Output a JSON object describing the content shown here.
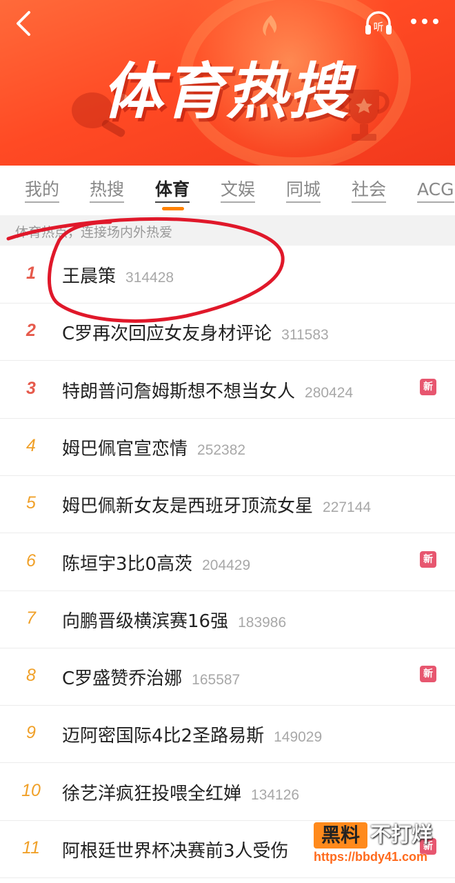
{
  "header": {
    "banner_title": "体育热搜",
    "listen_label": "听"
  },
  "tabs": [
    {
      "label": "我的"
    },
    {
      "label": "热搜"
    },
    {
      "label": "体育"
    },
    {
      "label": "文娱"
    },
    {
      "label": "同城"
    },
    {
      "label": "社会"
    },
    {
      "label": "ACG"
    }
  ],
  "active_tab": "体育",
  "subtitle": "体育热点，连接场内外热爱",
  "new_badge_label": "新",
  "items": [
    {
      "rank": "1",
      "title": "王晨策",
      "count": "314428",
      "is_new": false
    },
    {
      "rank": "2",
      "title": "C罗再次回应女友身材评论",
      "count": "311583",
      "is_new": false
    },
    {
      "rank": "3",
      "title": "特朗普问詹姆斯想不想当女人",
      "count": "280424",
      "is_new": true
    },
    {
      "rank": "4",
      "title": "姆巴佩官宣恋情",
      "count": "252382",
      "is_new": false
    },
    {
      "rank": "5",
      "title": "姆巴佩新女友是西班牙顶流女星",
      "count": "227144",
      "is_new": false
    },
    {
      "rank": "6",
      "title": "陈垣宇3比0高茨",
      "count": "204429",
      "is_new": true
    },
    {
      "rank": "7",
      "title": "向鹏晋级横滨赛16强",
      "count": "183986",
      "is_new": false
    },
    {
      "rank": "8",
      "title": "C罗盛赞乔治娜",
      "count": "165587",
      "is_new": true
    },
    {
      "rank": "9",
      "title": "迈阿密国际4比2圣路易斯",
      "count": "149029",
      "is_new": false
    },
    {
      "rank": "10",
      "title": "徐艺洋疯狂投喂全红婵",
      "count": "134126",
      "is_new": false
    },
    {
      "rank": "11",
      "title": "阿根廷世界杯决赛前3人受伤",
      "count": "",
      "is_new": true
    }
  ],
  "watermark": {
    "badge": "黑料",
    "text": "不打烊",
    "url": "https://bbdy41.com"
  },
  "colors": {
    "banner": "#ff4a24",
    "rank_top": "#e65a4c",
    "rank_low": "#f0a028",
    "new_badge": "#e7566f",
    "annotation_stroke": "#e0182a",
    "tab_indicator": "#ff8200"
  }
}
